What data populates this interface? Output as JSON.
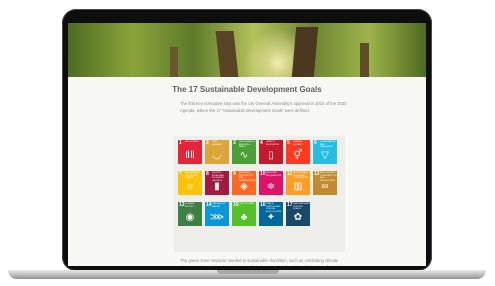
{
  "page": {
    "title": "The 17 Sustainable Development Goals",
    "intro": "The first key normative step was the UN General Assembly's approval in 2015 of the 2030 Agenda, where the 17 'Sustainable Development Goals' were defined.",
    "outro": "The green zone respects needed to sustainable transition, such as combating climate change, and social goals, such as quality education for all and the elimination of social hunger."
  },
  "goals": [
    {
      "num": "1",
      "label": "No poverty",
      "color": "#e5243b",
      "icon": "family-icon",
      "glyph": "ⅡⅡ"
    },
    {
      "num": "2",
      "label": "Zero hunger",
      "color": "#dda63a",
      "icon": "bowl-icon",
      "glyph": "◡"
    },
    {
      "num": "3",
      "label": "Good health and well-being",
      "color": "#4c9f38",
      "icon": "heartbeat-icon",
      "glyph": "∿"
    },
    {
      "num": "4",
      "label": "Quality education",
      "color": "#c5192d",
      "icon": "book-icon",
      "glyph": "▯"
    },
    {
      "num": "5",
      "label": "Gender equality",
      "color": "#ff3a21",
      "icon": "gender-icon",
      "glyph": "⚥"
    },
    {
      "num": "6",
      "label": "Clean water and sanitation",
      "color": "#26bde2",
      "icon": "water-icon",
      "glyph": "▽"
    },
    {
      "num": "7",
      "label": "Affordable and clean energy",
      "color": "#fcc30b",
      "icon": "sun-icon",
      "glyph": "☼"
    },
    {
      "num": "8",
      "label": "Decent work and economic growth",
      "color": "#a21942",
      "icon": "chart-icon",
      "glyph": "▮"
    },
    {
      "num": "9",
      "label": "Industry, innovation and infrastructure",
      "color": "#fd6925",
      "icon": "cubes-icon",
      "glyph": "◈"
    },
    {
      "num": "10",
      "label": "Reduced inequalities",
      "color": "#dd1367",
      "icon": "equal-icon",
      "glyph": "≑"
    },
    {
      "num": "11",
      "label": "Sustainable cities and communities",
      "color": "#fd9d24",
      "icon": "buildings-icon",
      "glyph": "▥"
    },
    {
      "num": "12",
      "label": "Responsible consumption and production",
      "color": "#bf8b2e",
      "icon": "infinity-icon",
      "glyph": "∞"
    },
    {
      "num": "13",
      "label": "Climate action",
      "color": "#3f7e44",
      "icon": "eye-icon",
      "glyph": "◉"
    },
    {
      "num": "14",
      "label": "Life below water",
      "color": "#0a97d9",
      "icon": "fish-icon",
      "glyph": "⋙"
    },
    {
      "num": "15",
      "label": "Life on land",
      "color": "#56c02b",
      "icon": "tree-icon",
      "glyph": "♣"
    },
    {
      "num": "16",
      "label": "Peace, justice and strong institutions",
      "color": "#00689d",
      "icon": "dove-icon",
      "glyph": "✦"
    },
    {
      "num": "17",
      "label": "Partnerships for the goals",
      "color": "#19486a",
      "icon": "rings-icon",
      "glyph": "✿"
    }
  ],
  "colors": {
    "screen_bg": "#f7f7f4",
    "bezel": "#0e0e0e",
    "title_text": "#5e5e5e"
  }
}
